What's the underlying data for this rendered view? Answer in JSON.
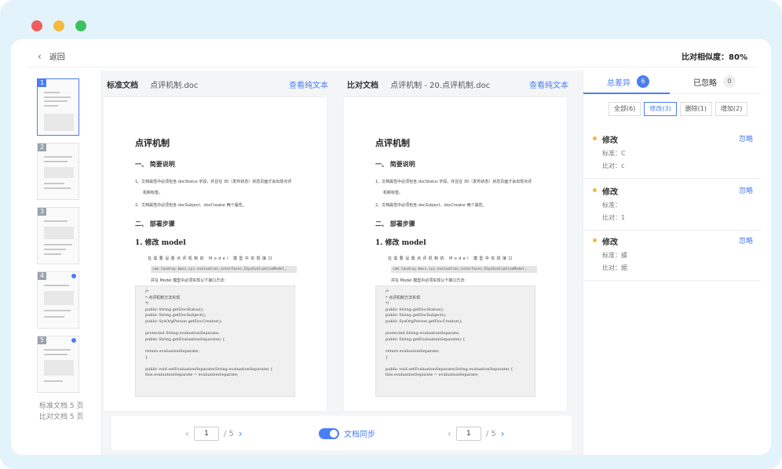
{
  "topbar": {
    "back_label": "返回",
    "similarity": "比对相似度：80%"
  },
  "thumbs": {
    "pages": [
      "1",
      "2",
      "3",
      "4",
      "5"
    ],
    "std_count": "标准文档 5 页",
    "cmp_count": "比对文档 5 页"
  },
  "left_doc": {
    "label": "标准文档",
    "name": "点评机制.doc",
    "view_plain": "查看纯文本"
  },
  "right_doc": {
    "label": "比对文档",
    "name": "点评机制 - 20.点评机制.doc",
    "view_plain": "查看纯文本"
  },
  "paper": {
    "title": "点评机制",
    "s1": "一、 简要说明",
    "l1": "1、文档属性中必须包含 docStatus 字段，并且在 30（发布状态）状态页面才会出现点评",
    "l1b": "机制标签。",
    "l2": "2、文档属性中必须包含 docSubject、docCreator 两个属性。",
    "s2": "二、 部署步骤",
    "s3": "1. 修改 model",
    "p1": "在需要设置点评机制的 Model 模型中实现接口",
    "hl": "com.landray.kmss.sys.evaluation.interfaces.ISysEvaluationModel,",
    "p2": "并在 Model 模型中必须实现以下接口方法：",
    "code": [
      "/*",
      " * 点评机制方法实现",
      " */",
      "public String getDocStatus();",
      "public String getDocSubject();",
      "public SysOrgPerson getDocCreator();",
      "",
      "protected String evaluationSeparate;",
      "    public String getEvaluationSeparate() {",
      "",
      "        return evaluationSeparate;",
      "    }",
      "",
      "public void setEvaluationSeparate(String evaluationSeparate) {",
      "        this.evaluationSeparate = evaluationSeparate;"
    ]
  },
  "pager": {
    "left_page": "1",
    "left_total": "/ 5",
    "right_page": "1",
    "right_total": "/ 5",
    "sync_label": "文档同步"
  },
  "right_panel": {
    "tab_total": "总差异",
    "tab_total_count": "6",
    "tab_ignored": "已忽略",
    "tab_ignored_count": "0",
    "filters": [
      "全部(6)",
      "修改(3)",
      "删除(1)",
      "增加(2)"
    ],
    "diffs": [
      {
        "type": "修改",
        "ignore": "忽略",
        "std": "标准：C",
        "cmp": "比对：c"
      },
      {
        "type": "修改",
        "ignore": "忽略",
        "std": "标准：",
        "cmp": "比对：1"
      },
      {
        "type": "修改",
        "ignore": "忽略",
        "std": "标准：據",
        "cmp": "比对：据"
      }
    ]
  },
  "colors": {
    "accent": "#4a7ef3",
    "diff_bullet": "#f5b940",
    "frame_bg": "#e2f3fb"
  }
}
